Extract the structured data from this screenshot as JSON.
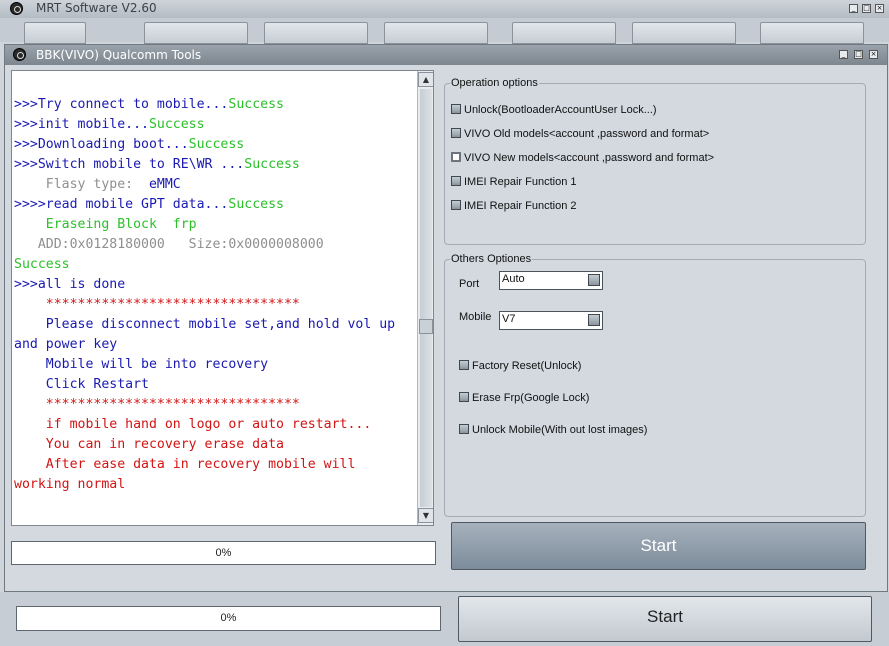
{
  "outer_window": {
    "title": "MRT Software V2.60",
    "progress_text": "0%",
    "start_label": "Start"
  },
  "inner_window": {
    "title": "BBK(VIVO) Qualcomm Tools",
    "progress_text": "0%",
    "start_label": "Start"
  },
  "log": {
    "lines": [
      [
        {
          "t": ">>>Try connect to mobile...",
          "c": "b"
        },
        {
          "t": "Success",
          "c": "g"
        }
      ],
      [
        {
          "t": ">>>init mobile...",
          "c": "b"
        },
        {
          "t": "Success",
          "c": "g"
        }
      ],
      [
        {
          "t": ">>>Downloading boot...",
          "c": "b"
        },
        {
          "t": "Success",
          "c": "g"
        }
      ],
      [
        {
          "t": ">>>Switch mobile to RE\\WR ...",
          "c": "b"
        },
        {
          "t": "Success",
          "c": "g"
        }
      ],
      [
        {
          "t": "    Flasy type:  ",
          "c": "gr"
        },
        {
          "t": "eMMC",
          "c": "b"
        }
      ],
      [
        {
          "t": ">>>>read mobile GPT data...",
          "c": "b"
        },
        {
          "t": "Success",
          "c": "g"
        }
      ],
      [
        {
          "t": "    Eraseing Block  frp",
          "c": "g"
        }
      ],
      [
        {
          "t": "   ADD:0x0128180000   Size:0x0000008000",
          "c": "gr"
        }
      ],
      [
        {
          "t": "Success",
          "c": "g"
        }
      ],
      [
        {
          "t": ">>>all is done",
          "c": "b"
        }
      ],
      [
        {
          "t": "    ********************************",
          "c": "r"
        }
      ],
      [
        {
          "t": "    Please disconnect mobile set,and hold vol up",
          "c": "b"
        }
      ],
      [
        {
          "t": "and power key",
          "c": "b"
        }
      ],
      [
        {
          "t": "    Mobile will be into recovery",
          "c": "b"
        }
      ],
      [
        {
          "t": "    Click Restart",
          "c": "b"
        }
      ],
      [
        {
          "t": "    ********************************",
          "c": "r"
        }
      ],
      [
        {
          "t": "    if mobile hand on logo or auto restart...",
          "c": "r"
        }
      ],
      [
        {
          "t": "    You can in recovery erase data",
          "c": "r"
        }
      ],
      [
        {
          "t": "    After ease data in recovery mobile will",
          "c": "r"
        }
      ],
      [
        {
          "t": "working normal",
          "c": "r"
        }
      ]
    ]
  },
  "operation_options": {
    "title": "Operation options",
    "items": [
      "Unlock(BootloaderAccountUser Lock...)",
      "VIVO Old models<account ,password and format>",
      "VIVO New models<account ,password and format>",
      "IMEI Repair Function 1",
      "IMEI Repair Function 2"
    ]
  },
  "other_options": {
    "title": "Others Optiones",
    "port_label": "Port",
    "port_value": "Auto",
    "mobile_label": "Mobile",
    "mobile_value": "V7",
    "items": [
      "Factory Reset(Unlock)",
      "Erase Frp(Google Lock)",
      "Unlock Mobile(With out lost images)"
    ]
  },
  "colors": {
    "log_blue": "#1a1ab2",
    "log_green": "#2bc02b",
    "log_gray": "#8f8f8f",
    "log_red": "#d21414"
  }
}
